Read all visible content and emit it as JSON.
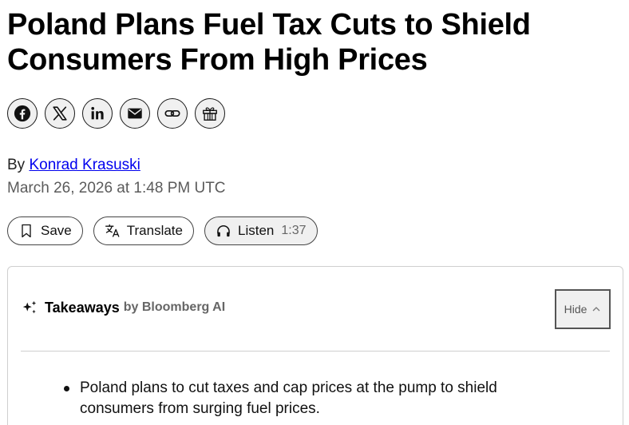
{
  "article": {
    "headline": "Poland Plans Fuel Tax Cuts to Shield Consumers From High Prices",
    "byline_prefix": "By",
    "author": "Konrad Krasuski",
    "timestamp": "March 26, 2026 at 1:48 PM UTC"
  },
  "share": {
    "icons": [
      "facebook-icon",
      "x-icon",
      "linkedin-icon",
      "email-icon",
      "link-icon",
      "gift-icon"
    ]
  },
  "actions": {
    "save_label": "Save",
    "translate_label": "Translate",
    "listen_label": "Listen",
    "listen_duration": "1:37"
  },
  "takeaways": {
    "title": "Takeaways",
    "by": "by Bloomberg AI",
    "hide_label": "Hide",
    "items": [
      "Poland plans to cut taxes and cap prices at the pump to shield consumers from surging fuel prices."
    ]
  }
}
